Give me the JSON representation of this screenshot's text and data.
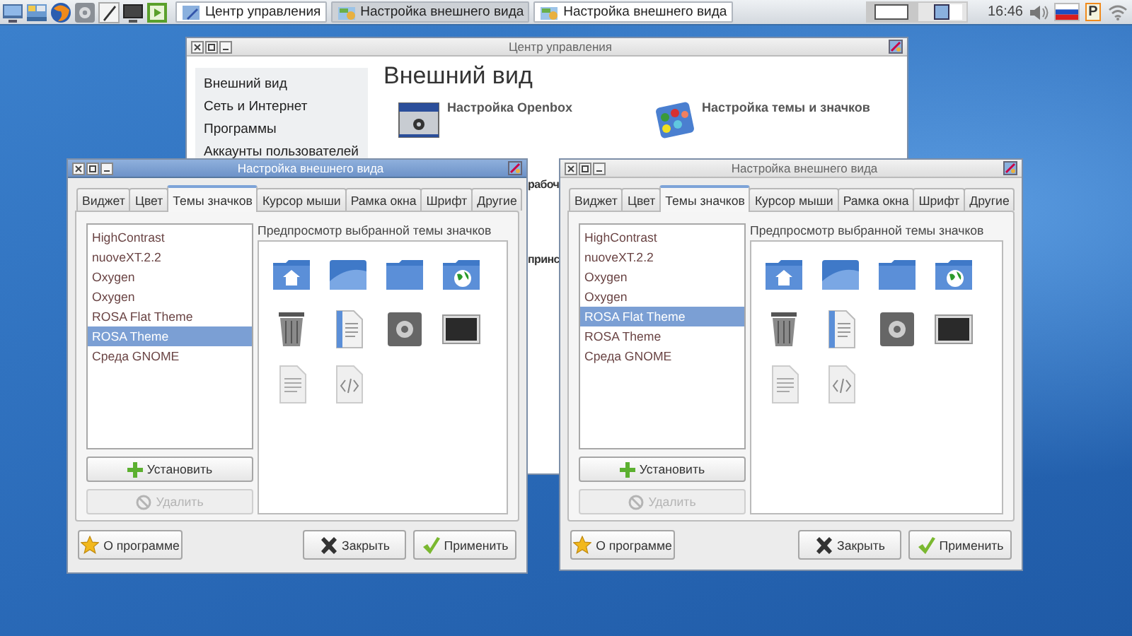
{
  "taskbar": {
    "tasks": [
      {
        "label": "Центр управления",
        "selected": false
      },
      {
        "label": "Настройка внешнего вида",
        "selected": true
      },
      {
        "label": "Настройка внешнего вида",
        "selected": false
      }
    ],
    "pager": [
      {
        "selected": false
      },
      {
        "selected": true
      }
    ],
    "clock": "16:46",
    "layout_badge": "P"
  },
  "control_center": {
    "title": "Центр управления",
    "sidebar": {
      "items": [
        "Внешний вид",
        "Сеть и Интернет",
        "Программы",
        "Аккаунты пользователей"
      ]
    },
    "heading": "Внешний вид",
    "items": [
      {
        "label": "Настройка Openbox",
        "kind": "openbox"
      },
      {
        "label": "Настройка темы и значков",
        "kind": "palette"
      }
    ],
    "partly_hidden": [
      "рабоч",
      "принс"
    ]
  },
  "dialogs": [
    {
      "title": "Настройка внешнего вида",
      "active": true,
      "tabs": [
        {
          "label": "Виджет",
          "selected": false
        },
        {
          "label": "Цвет",
          "selected": false
        },
        {
          "label": "Темы значков",
          "selected": true
        },
        {
          "label": "Курсор мыши",
          "selected": false
        },
        {
          "label": "Рамка окна",
          "selected": false
        },
        {
          "label": "Шрифт",
          "selected": false
        },
        {
          "label": "Другие",
          "selected": false
        }
      ],
      "themes": [
        {
          "label": "HighContrast",
          "selected": false
        },
        {
          "label": "nuoveXT.2.2",
          "selected": false
        },
        {
          "label": "Oxygen",
          "selected": false
        },
        {
          "label": "Oxygen",
          "selected": false
        },
        {
          "label": "ROSA Flat Theme",
          "selected": false
        },
        {
          "label": "ROSA Theme",
          "selected": true
        },
        {
          "label": "Среда GNOME",
          "selected": false
        }
      ],
      "preview_label": "Предпросмотр выбранной темы значков",
      "install_button": {
        "label": "Установить"
      },
      "remove_button": {
        "label": "Удалить",
        "disabled": true
      },
      "about_button": "О программе",
      "close_button": "Закрыть",
      "apply_button": "Применить"
    },
    {
      "title": "Настройка внешнего вида",
      "active": false,
      "tabs": [
        {
          "label": "Виджет",
          "selected": false
        },
        {
          "label": "Цвет",
          "selected": false
        },
        {
          "label": "Темы значков",
          "selected": true
        },
        {
          "label": "Курсор мыши",
          "selected": false
        },
        {
          "label": "Рамка окна",
          "selected": false
        },
        {
          "label": "Шрифт",
          "selected": false
        },
        {
          "label": "Другие",
          "selected": false
        }
      ],
      "themes": [
        {
          "label": "HighContrast",
          "selected": false
        },
        {
          "label": "nuoveXT.2.2",
          "selected": false
        },
        {
          "label": "Oxygen",
          "selected": false
        },
        {
          "label": "Oxygen",
          "selected": false
        },
        {
          "label": "ROSA Flat Theme",
          "selected": true
        },
        {
          "label": "ROSA Theme",
          "selected": false
        },
        {
          "label": "Среда GNOME",
          "selected": false
        }
      ],
      "preview_label": "Предпросмотр выбранной темы значков",
      "install_button": {
        "label": "Установить"
      },
      "remove_button": {
        "label": "Удалить",
        "disabled": true
      },
      "about_button": "О программе",
      "close_button": "Закрыть",
      "apply_button": "Применить"
    }
  ]
}
